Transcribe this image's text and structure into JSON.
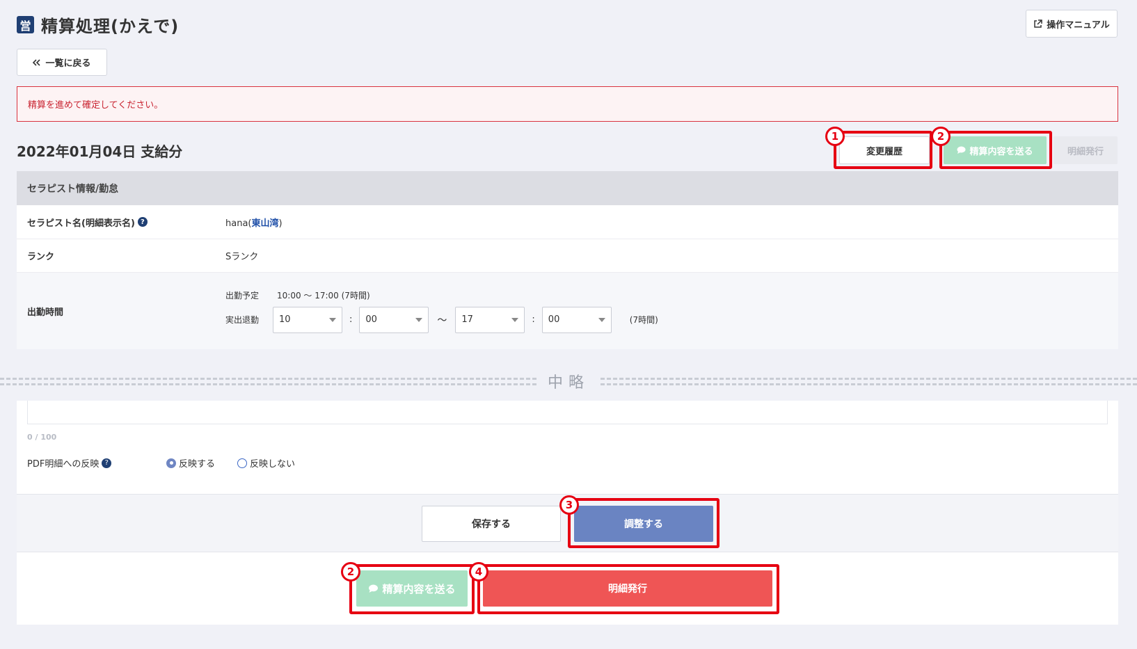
{
  "header": {
    "title_icon": "営",
    "title": "精算処理(かえで)",
    "manual_label": "操作マニュアル",
    "back_label": "一覧に戻る"
  },
  "alert": {
    "message": "精算を進めて確定してください。"
  },
  "section": {
    "title": "2022年01月04日 支給分",
    "history_label": "変更履歴",
    "send_label": "精算内容を送る",
    "issue_label": "明細発行"
  },
  "annotations": {
    "b1": "1",
    "b2": "2",
    "b3": "3",
    "b4": "4"
  },
  "therapist": {
    "heading": "セラピスト情報/勤怠",
    "name_label": "セラピスト名(明細表示名)",
    "name_value": "hana(",
    "name_store": "東山湾",
    "name_close": ")",
    "rank_label": "ランク",
    "rank_value": "Sランク",
    "work_label": "出勤時間",
    "planned_label": "出勤予定",
    "planned_value": "10:00 〜 17:00  (7時間)",
    "actual_label": "実出退勤",
    "start_hour": "10",
    "start_min": "00",
    "tilde": "〜",
    "end_hour": "17",
    "end_min": "00",
    "actual_total": "(7時間)"
  },
  "omitted": {
    "text": "中略"
  },
  "bottom": {
    "counter": "0 / 100",
    "pdf_label": "PDF明細への反映",
    "radio_yes": "反映する",
    "radio_no": "反映しない",
    "save_label": "保存する",
    "adjust_label": "調整する",
    "send_label": "精算内容を送る",
    "issue_label": "明細発行"
  },
  "colors": {
    "highlight": "#e60012",
    "send_green": "#a8e1c3",
    "adjust_blue": "#6a84c2",
    "issue_red": "#ef5555"
  }
}
